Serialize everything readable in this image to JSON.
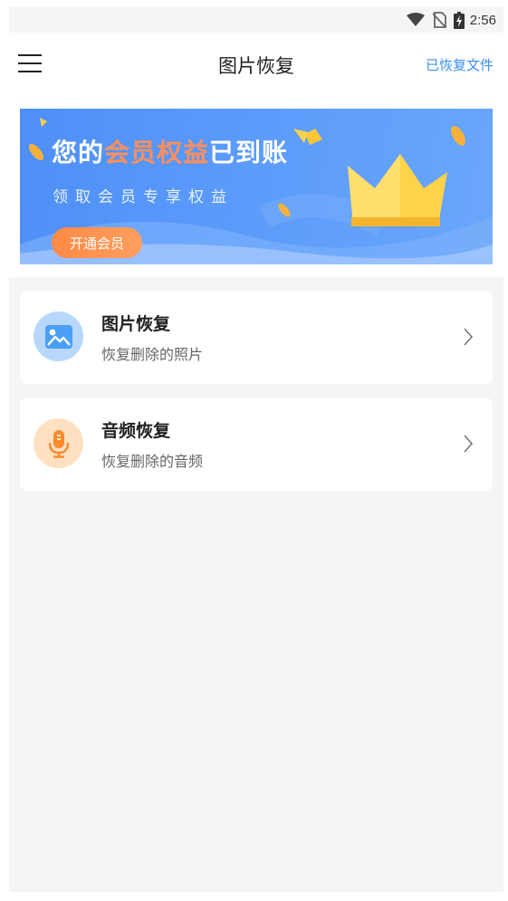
{
  "status_bar": {
    "time": "2:56",
    "icons": [
      "wifi-icon",
      "no-sim-icon",
      "battery-charging-icon"
    ]
  },
  "nav": {
    "menu_icon": "menu-icon",
    "title": "图片恢复",
    "right_link": "已恢复文件"
  },
  "banner": {
    "title_prefix": "您的",
    "title_highlight": "会员权益",
    "title_suffix": "已到账",
    "subtitle": "领取会员专享权益",
    "button_label": "开通会员",
    "accent_color": "#ff8f5c"
  },
  "features": [
    {
      "title": "图片恢复",
      "subtitle": "恢复删除的照片",
      "icon": "image-icon",
      "icon_bg": "#b8d7fb",
      "icon_color": "#4b9ef5"
    },
    {
      "title": "音频恢复",
      "subtitle": "恢复删除的音频",
      "icon": "microphone-icon",
      "icon_bg": "#ffe1c2",
      "icon_color": "#fb8a2b"
    }
  ],
  "colors": {
    "link": "#3b8ff0",
    "page_bg": "#f4f5f7"
  }
}
